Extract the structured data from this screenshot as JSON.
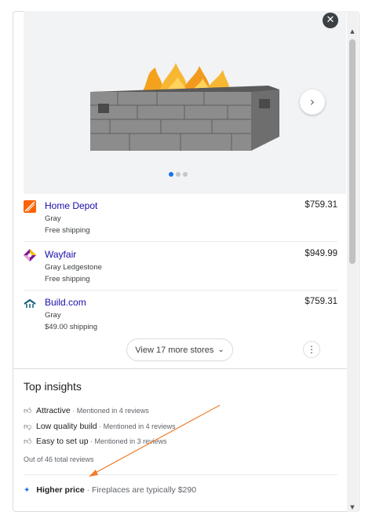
{
  "product_panel": {
    "close_glyph": "✕",
    "next_glyph": "›",
    "image_alt": "Rectangular gray stone fire pit table with flames",
    "carousel_count": 3,
    "carousel_active": 1
  },
  "stores": [
    {
      "name": "Home Depot",
      "variant": "Gray",
      "shipping": "Free shipping",
      "price": "$759.31",
      "logo_color": "#f96302"
    },
    {
      "name": "Wayfair",
      "variant": "Gray Ledgestone",
      "shipping": "Free shipping",
      "price": "$949.99",
      "logo_color": "#7b189f"
    },
    {
      "name": "Build.com",
      "variant": "Gray",
      "shipping": "$49.00 shipping",
      "price": "$759.31",
      "logo_color": "#0f5b78"
    }
  ],
  "more_stores": {
    "label": "View 17 more stores",
    "chevron": "⌄",
    "menu_glyph": "⋮"
  },
  "insights": {
    "title": "Top insights",
    "items": [
      {
        "label": "Attractive",
        "meta": " · Mentioned in 4 reviews",
        "icon": "thumbs-up-icon"
      },
      {
        "label": "Low quality build",
        "meta": " · Mentioned in 4 reviews",
        "icon": "thumbs-down-icon"
      },
      {
        "label": "Easy to set up",
        "meta": " · Mentioned in 3 reviews",
        "icon": "thumbs-up-icon"
      }
    ],
    "total": "Out of 46 total reviews",
    "price_insight": {
      "label": "Higher price",
      "meta": " · Fireplaces are typically $290",
      "icon": "sparkle-icon"
    }
  },
  "colors": {
    "accent": "#1a73e8",
    "link": "#1a0dab",
    "annotation": "#f07d2a"
  }
}
